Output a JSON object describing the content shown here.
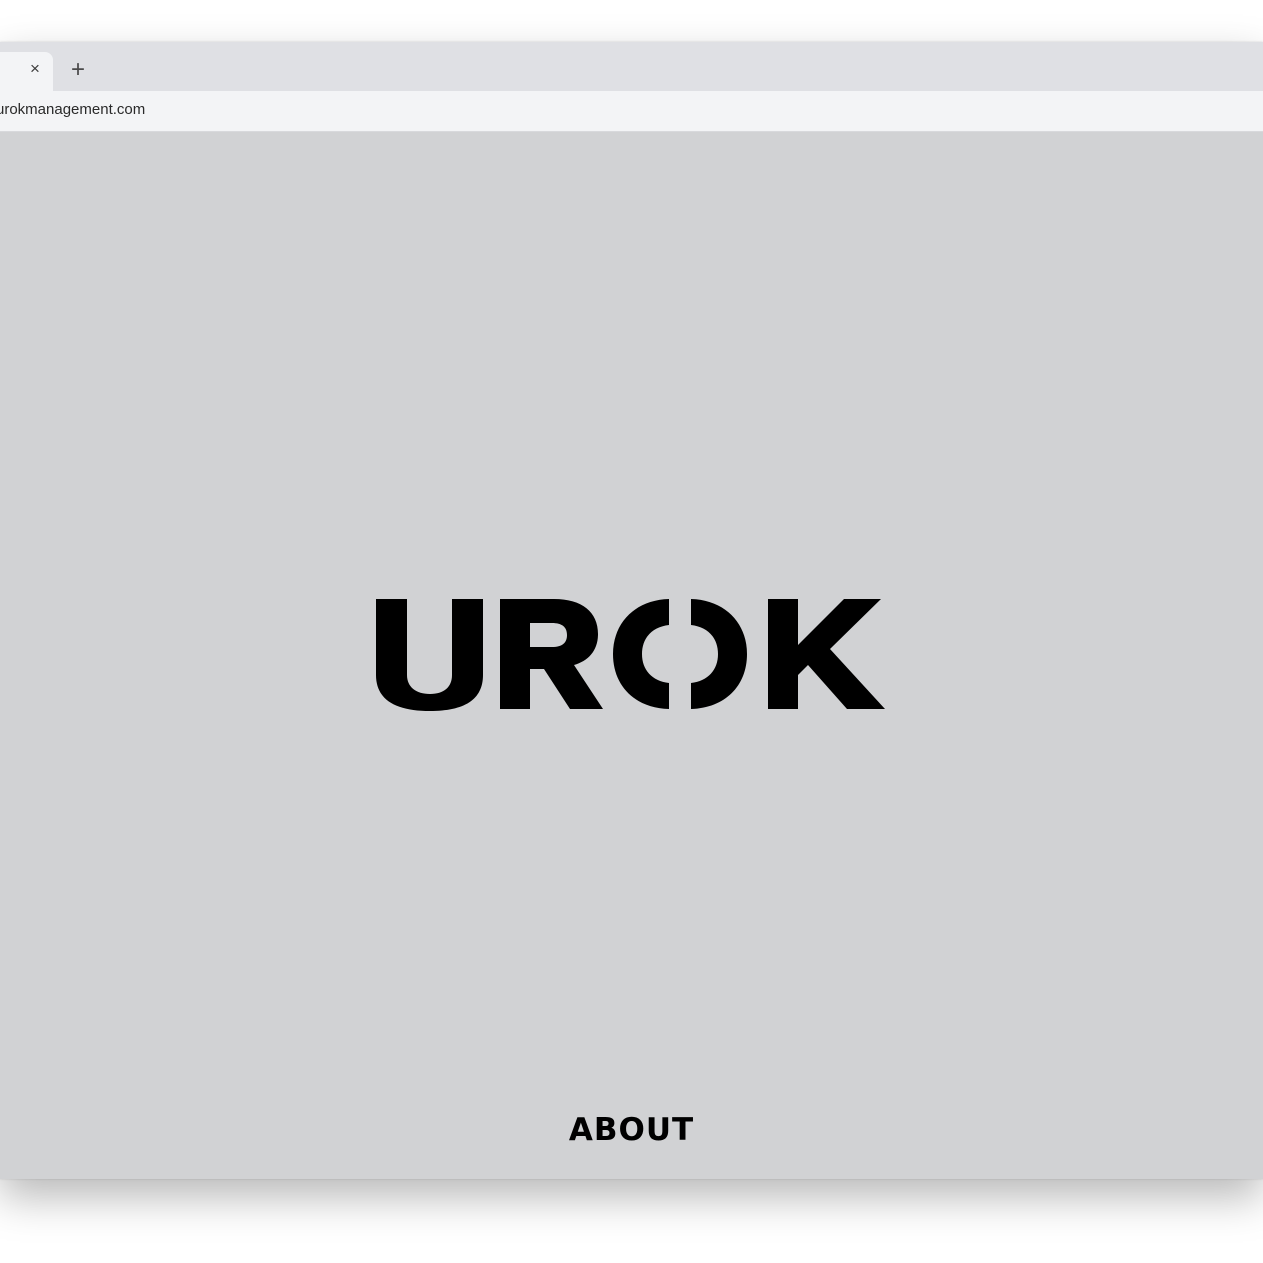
{
  "browser": {
    "tab": {
      "close_icon": "close-icon",
      "close_glyph": "×"
    },
    "new_tab_icon": "plus-icon",
    "new_tab_glyph": "+",
    "address_bar": {
      "url": "urokmanagement.com"
    }
  },
  "page": {
    "logo_text": "UROK",
    "nav": {
      "about_label": "ABOUT"
    }
  },
  "colors": {
    "page_background": "#d1d2d4",
    "logo": "#000000",
    "tabstrip": "#dfe0e4",
    "active_tab": "#f3f4f6"
  }
}
